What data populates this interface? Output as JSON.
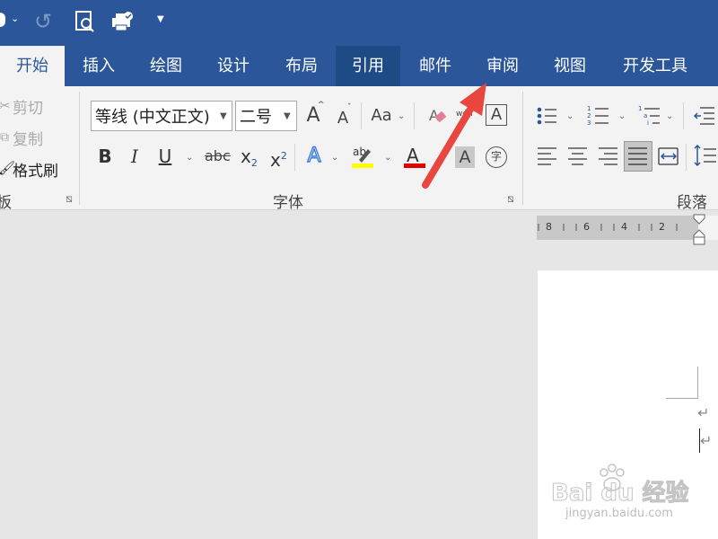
{
  "quick_access": {
    "icons": [
      "save-icon",
      "undo-dropdown-icon",
      "redo-icon",
      "print-preview-icon",
      "quick-print-icon",
      "customize-icon"
    ]
  },
  "tabs": [
    {
      "label": "开始",
      "active": true
    },
    {
      "label": "插入"
    },
    {
      "label": "绘图"
    },
    {
      "label": "设计"
    },
    {
      "label": "布局"
    },
    {
      "label": "引用",
      "highlighted": true
    },
    {
      "label": "邮件"
    },
    {
      "label": "审阅"
    },
    {
      "label": "视图"
    },
    {
      "label": "开发工具"
    }
  ],
  "clipboard": {
    "cut": "剪切",
    "copy": "复制",
    "format_painter": "格式刷",
    "group_label": "板"
  },
  "font": {
    "font_name": "等线 (中文正文)",
    "font_size": "二号",
    "change_case": "Aa",
    "grow_glyph": "A",
    "shrink_glyph": "A",
    "bold": "B",
    "italic": "I",
    "underline": "U",
    "strike": "abc",
    "subscript": "x",
    "subscript_digit": "2",
    "superscript": "x",
    "superscript_digit": "2",
    "text_effects": "A",
    "highlight_text": "ab",
    "font_color": "A",
    "char_shading": "A",
    "enclose_char": "字",
    "group_label": "字体",
    "phonetic": "wén",
    "border_char": "A"
  },
  "paragraph": {
    "group_label": "段落"
  },
  "ruler": {
    "marks": [
      "8",
      "6",
      "4",
      "2"
    ]
  },
  "watermark": {
    "brand": "Bai du 经验",
    "url": "jingyan.baidu.com"
  },
  "colors": {
    "title_bar": "#2b579a",
    "ribbon": "#f3f3f3",
    "annotation_arrow": "#e8463f",
    "highlight_yellow": "#ffff00",
    "font_red": "#e00000"
  }
}
